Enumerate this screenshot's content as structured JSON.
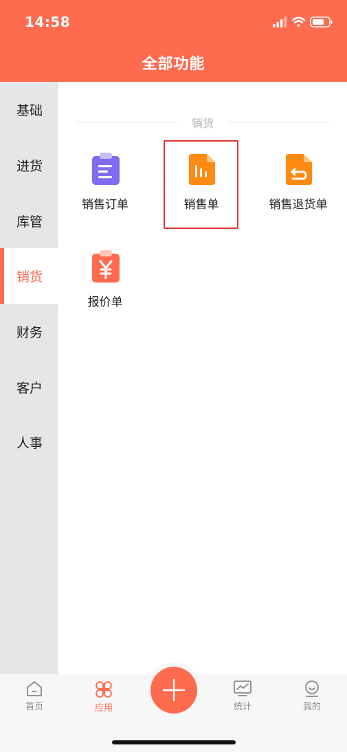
{
  "status_bar": {
    "time": "14:58"
  },
  "header": {
    "title": "全部功能"
  },
  "sidebar": {
    "items": [
      {
        "label": "基础"
      },
      {
        "label": "进货"
      },
      {
        "label": "库管"
      },
      {
        "label": "销货"
      },
      {
        "label": "财务"
      },
      {
        "label": "客户"
      },
      {
        "label": "人事"
      }
    ],
    "active_index": 3
  },
  "section": {
    "title": "销货",
    "apps": [
      {
        "label": "销售订单",
        "icon": "clipboard-list-icon",
        "color": "#7f6cf0"
      },
      {
        "label": "销售单",
        "icon": "bar-chart-document-icon",
        "color": "#ff8a12",
        "highlighted": true
      },
      {
        "label": "销售退货单",
        "icon": "return-document-icon",
        "color": "#ff8a12"
      },
      {
        "label": "报价单",
        "icon": "yen-clipboard-icon",
        "color": "#ff6b4f"
      }
    ]
  },
  "tabbar": {
    "tabs": [
      {
        "label": "首页",
        "icon": "home-icon"
      },
      {
        "label": "应用",
        "icon": "apps-icon",
        "active": true
      },
      {
        "label": "统计",
        "icon": "chart-monitor-icon"
      },
      {
        "label": "我的",
        "icon": "smile-user-icon"
      }
    ],
    "fab_icon": "plus-icon"
  },
  "colors": {
    "accent": "#ff6b4f",
    "sidebar_bg": "#e6e6e8",
    "highlight": "#e3342f"
  }
}
